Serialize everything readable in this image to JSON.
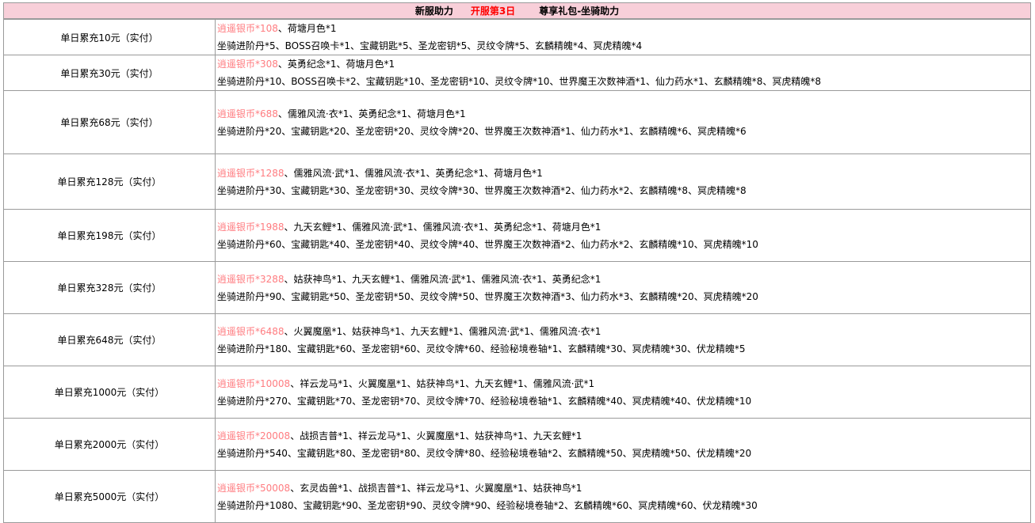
{
  "header": {
    "title1": "新服助力",
    "title2": "开服第3日",
    "title3": "尊享礼包-坐骑助力"
  },
  "colors": {
    "header_bg": "#f8cfd9",
    "highlight_text": "#ff0000",
    "coin_text": "#ff7c80",
    "border": "#9a9a9a"
  },
  "rows": [
    {
      "tier": "单日累充10元（实付）",
      "coin": "逍遥银币*108",
      "line1": "、荷塘月色*1",
      "line2": "坐骑进阶丹*5、BOSS召唤卡*1、宝藏钥匙*5、圣龙密钥*5、灵纹令牌*5、玄麟精魄*4、冥虎精魄*4"
    },
    {
      "tier": "单日累充30元（实付）",
      "coin": "逍遥银币*308",
      "line1": "、英勇纪念*1、荷塘月色*1",
      "line2": "坐骑进阶丹*10、BOSS召唤卡*2、宝藏钥匙*10、圣龙密钥*10、灵纹令牌*10、世界魔王次数神酒*1、仙力药水*1、玄麟精魄*8、冥虎精魄*8"
    },
    {
      "tier": "单日累充68元（实付）",
      "coin": "逍遥银币*688",
      "line1": "、儒雅风流·衣*1、英勇纪念*1、荷塘月色*1",
      "line2": "坐骑进阶丹*20、宝藏钥匙*20、圣龙密钥*20、灵纹令牌*20、世界魔王次数神酒*1、仙力药水*1、玄麟精魄*6、冥虎精魄*6"
    },
    {
      "tier": "单日累充128元（实付）",
      "coin": "逍遥银币*1288",
      "line1": "、儒雅风流·武*1、儒雅风流·衣*1、英勇纪念*1、荷塘月色*1",
      "line2": "坐骑进阶丹*30、宝藏钥匙*30、圣龙密钥*30、灵纹令牌*30、世界魔王次数神酒*2、仙力药水*2、玄麟精魄*8、冥虎精魄*8"
    },
    {
      "tier": "单日累充198元（实付）",
      "coin": "逍遥银币*1988",
      "line1": "、九天玄鲤*1、儒雅风流·武*1、儒雅风流·衣*1、英勇纪念*1、荷塘月色*1",
      "line2": "坐骑进阶丹*60、宝藏钥匙*40、圣龙密钥*40、灵纹令牌*40、世界魔王次数神酒*2、仙力药水*2、玄麟精魄*10、冥虎精魄*10"
    },
    {
      "tier": "单日累充328元（实付）",
      "coin": "逍遥银币*3288",
      "line1": "、姑获神鸟*1、九天玄鲤*1、儒雅风流·武*1、儒雅风流·衣*1、英勇纪念*1",
      "line2": "坐骑进阶丹*90、宝藏钥匙*50、圣龙密钥*50、灵纹令牌*50、世界魔王次数神酒*3、仙力药水*3、玄麟精魄*20、冥虎精魄*20"
    },
    {
      "tier": "单日累充648元（实付）",
      "coin": "逍遥银币*6488",
      "line1": "、火翼魔凰*1、姑获神鸟*1、九天玄鲤*1、儒雅风流·武*1、儒雅风流·衣*1",
      "line2": "坐骑进阶丹*180、宝藏钥匙*60、圣龙密钥*60、灵纹令牌*60、经验秘境卷轴*1、玄麟精魄*30、冥虎精魄*30、伏龙精魄*5"
    },
    {
      "tier": "单日累充1000元（实付）",
      "coin": "逍遥银币*10008",
      "line1": "、祥云龙马*1、火翼魔凰*1、姑获神鸟*1、九天玄鲤*1、儒雅风流·武*1",
      "line2": "坐骑进阶丹*270、宝藏钥匙*70、圣龙密钥*70、灵纹令牌*70、经验秘境卷轴*1、玄麟精魄*40、冥虎精魄*40、伏龙精魄*10"
    },
    {
      "tier": "单日累充2000元（实付）",
      "coin": "逍遥银币*20008",
      "line1": "、战损吉普*1、祥云龙马*1、火翼魔凰*1、姑获神鸟*1、九天玄鲤*1",
      "line2": "坐骑进阶丹*540、宝藏钥匙*80、圣龙密钥*80、灵纹令牌*80、经验秘境卷轴*2、玄麟精魄*50、冥虎精魄*50、伏龙精魄*20"
    },
    {
      "tier": "单日累充5000元（实付）",
      "coin": "逍遥银币*50008",
      "line1": "、玄灵齿兽*1、战损吉普*1、祥云龙马*1、火翼魔凰*1、姑获神鸟*1",
      "line2": "坐骑进阶丹*1080、宝藏钥匙*90、圣龙密钥*90、灵纹令牌*90、经验秘境卷轴*2、玄麟精魄*60、冥虎精魄*60、伏龙精魄*30"
    }
  ]
}
